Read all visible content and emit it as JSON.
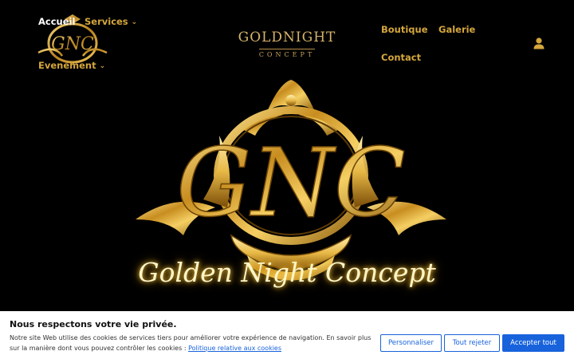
{
  "header": {
    "nav": {
      "accueil": "Accueil",
      "services": "Services",
      "evenement": "Evenement",
      "boutique": "Boutique",
      "galerie": "Galerie",
      "contact": "Contact"
    },
    "brand": {
      "main": "GOLDNIGHT",
      "sub": "CONCEPT"
    },
    "logo_initials": "GNC"
  },
  "hero": {
    "initials": "GNC",
    "tagline": "Golden Night Concept"
  },
  "cookie_banner": {
    "title": "Nous respectons votre vie privée.",
    "text": "Notre site Web utilise des cookies de services tiers pour améliorer votre expérience de navigation. En savoir plus sur la manière dont vous pouvez contrôler les cookies : ",
    "link": "Politique relative aux cookies",
    "buttons": {
      "customize": "Personnaliser",
      "reject": "Tout rejeter",
      "accept": "Accepter tout"
    }
  },
  "colors": {
    "background": "#000000",
    "gold": "#d4a63c",
    "accent_blue": "#1863dc"
  }
}
